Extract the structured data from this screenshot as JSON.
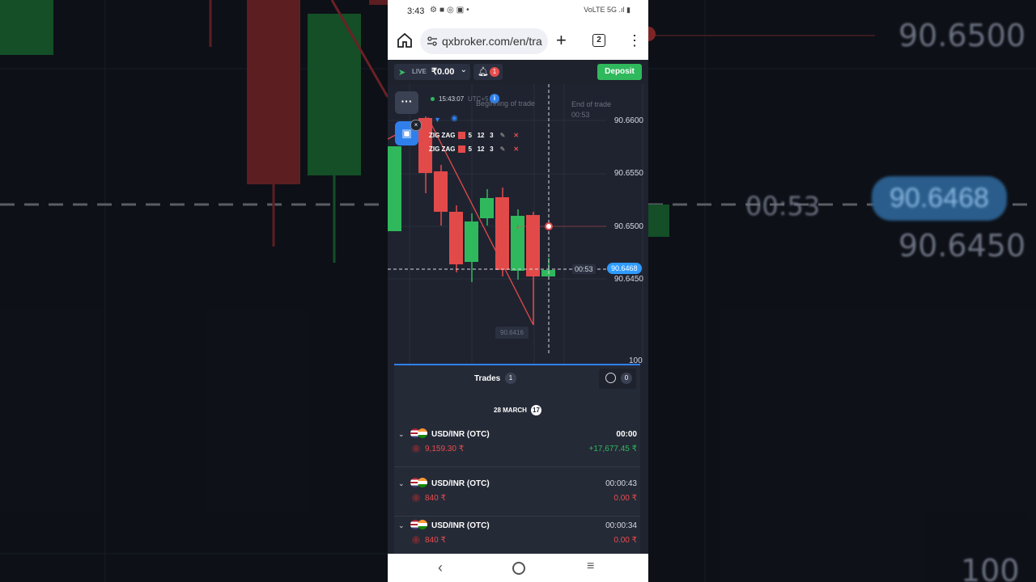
{
  "status_bar": {
    "time": "3:43",
    "right_icons": "VoLTE 5G .ıl ▮"
  },
  "browser": {
    "url": "qxbroker.com/en/tra",
    "tab_count": "2"
  },
  "app_header": {
    "mode": "LIVE",
    "balance": "₹0.00",
    "notifications": "1",
    "deposit_label": "Deposit"
  },
  "chart": {
    "clock": "15:43:07",
    "utc": "UTC+5",
    "begin_label": "Beginning of trade",
    "end_label": "End of trade",
    "end_countdown": "00:53",
    "price_levels": [
      "90.6600",
      "90.6550",
      "90.6500",
      "90.6450"
    ],
    "current_time": "00:53",
    "current_price": "90.6468",
    "low_label": "90.6416",
    "indicator_level": "100",
    "indicators": [
      {
        "name": "ZIG ZAG",
        "p1": "5",
        "p2": "12",
        "p3": "3"
      },
      {
        "name": "ZIG ZAG",
        "p1": "5",
        "p2": "12",
        "p3": "3"
      }
    ]
  },
  "trades": {
    "title": "Trades",
    "count": "1",
    "history_count": "0",
    "date_label": "28 MARCH",
    "date_badge": "17",
    "items": [
      {
        "pair": "USD/INR (OTC)",
        "timer": "00:00",
        "amount": "9,159.30 ₹",
        "profit": "+17,677.45 ₹"
      },
      {
        "pair": "USD/INR (OTC)",
        "timer": "00:00:43",
        "amount": "840 ₹",
        "profit": "0.00 ₹"
      },
      {
        "pair": "USD/INR (OTC)",
        "timer": "00:00:34",
        "amount": "840 ₹",
        "profit": "0.00 ₹"
      }
    ]
  },
  "background": {
    "left_time": "00:53",
    "right_prices": [
      "90.6500",
      "90.6468",
      "90.6450",
      "100"
    ]
  },
  "colors": {
    "up": "#2fb95c",
    "down": "#e24a4a",
    "accent": "#2f80ed",
    "bg": "#1f2330"
  }
}
